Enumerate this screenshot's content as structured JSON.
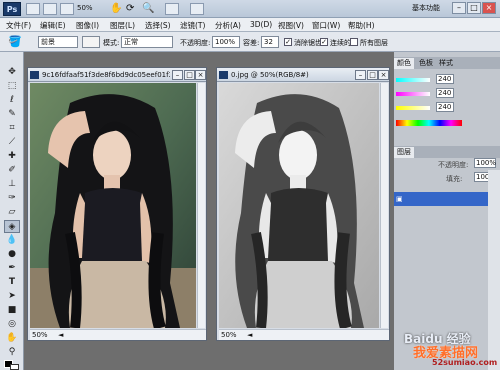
{
  "appbar": {
    "logo": "Ps",
    "zoom": "50%",
    "workspace": "基本功能"
  },
  "menu": [
    "文件(F)",
    "编辑(E)",
    "图像(I)",
    "图层(L)",
    "选择(S)",
    "滤镜(T)",
    "分析(A)",
    "3D(D)",
    "视图(V)",
    "窗口(W)",
    "帮助(H)"
  ],
  "options": {
    "sample_label": "前景",
    "mode_label": "模式:",
    "mode_value": "正常",
    "opacity_label": "不透明度:",
    "opacity_value": "100%",
    "tolerance_label": "容差:",
    "tolerance_value": "32",
    "antialias_label": "消除锯齿",
    "contiguous_label": "连续的",
    "all_layers_label": "所有图层"
  },
  "doc1": {
    "title": "9c16fdfaaf51f3de8f6bd9dc05eef01f3b2...",
    "zoom": "50%"
  },
  "doc2": {
    "title": "0.jpg @ 50%(RGB/8#)",
    "zoom": "50%"
  },
  "panel": {
    "tabs": [
      "颜色",
      "色板",
      "样式"
    ],
    "values": [
      "240",
      "240",
      "240"
    ],
    "layers_tab": "图层",
    "opacity_label": "不透明度:",
    "opacity_value": "100%",
    "fill_label": "填充:",
    "fill_value": "100%"
  },
  "watermark": {
    "brand": "Baidu 经验",
    "site_cn": "我爱素描网",
    "site_url": "52sumiao.com"
  },
  "tool_icons": [
    "move-icon",
    "marquee-icon",
    "lasso-icon",
    "quick-select-icon",
    "crop-icon",
    "eyedropper-icon",
    "healing-icon",
    "brush-icon",
    "stamp-icon",
    "history-brush-icon",
    "eraser-icon",
    "gradient-icon",
    "blur-icon",
    "dodge-icon",
    "pen-icon",
    "type-icon",
    "path-select-icon",
    "shape-icon",
    "3d-icon",
    "hand-icon",
    "zoom-icon"
  ]
}
